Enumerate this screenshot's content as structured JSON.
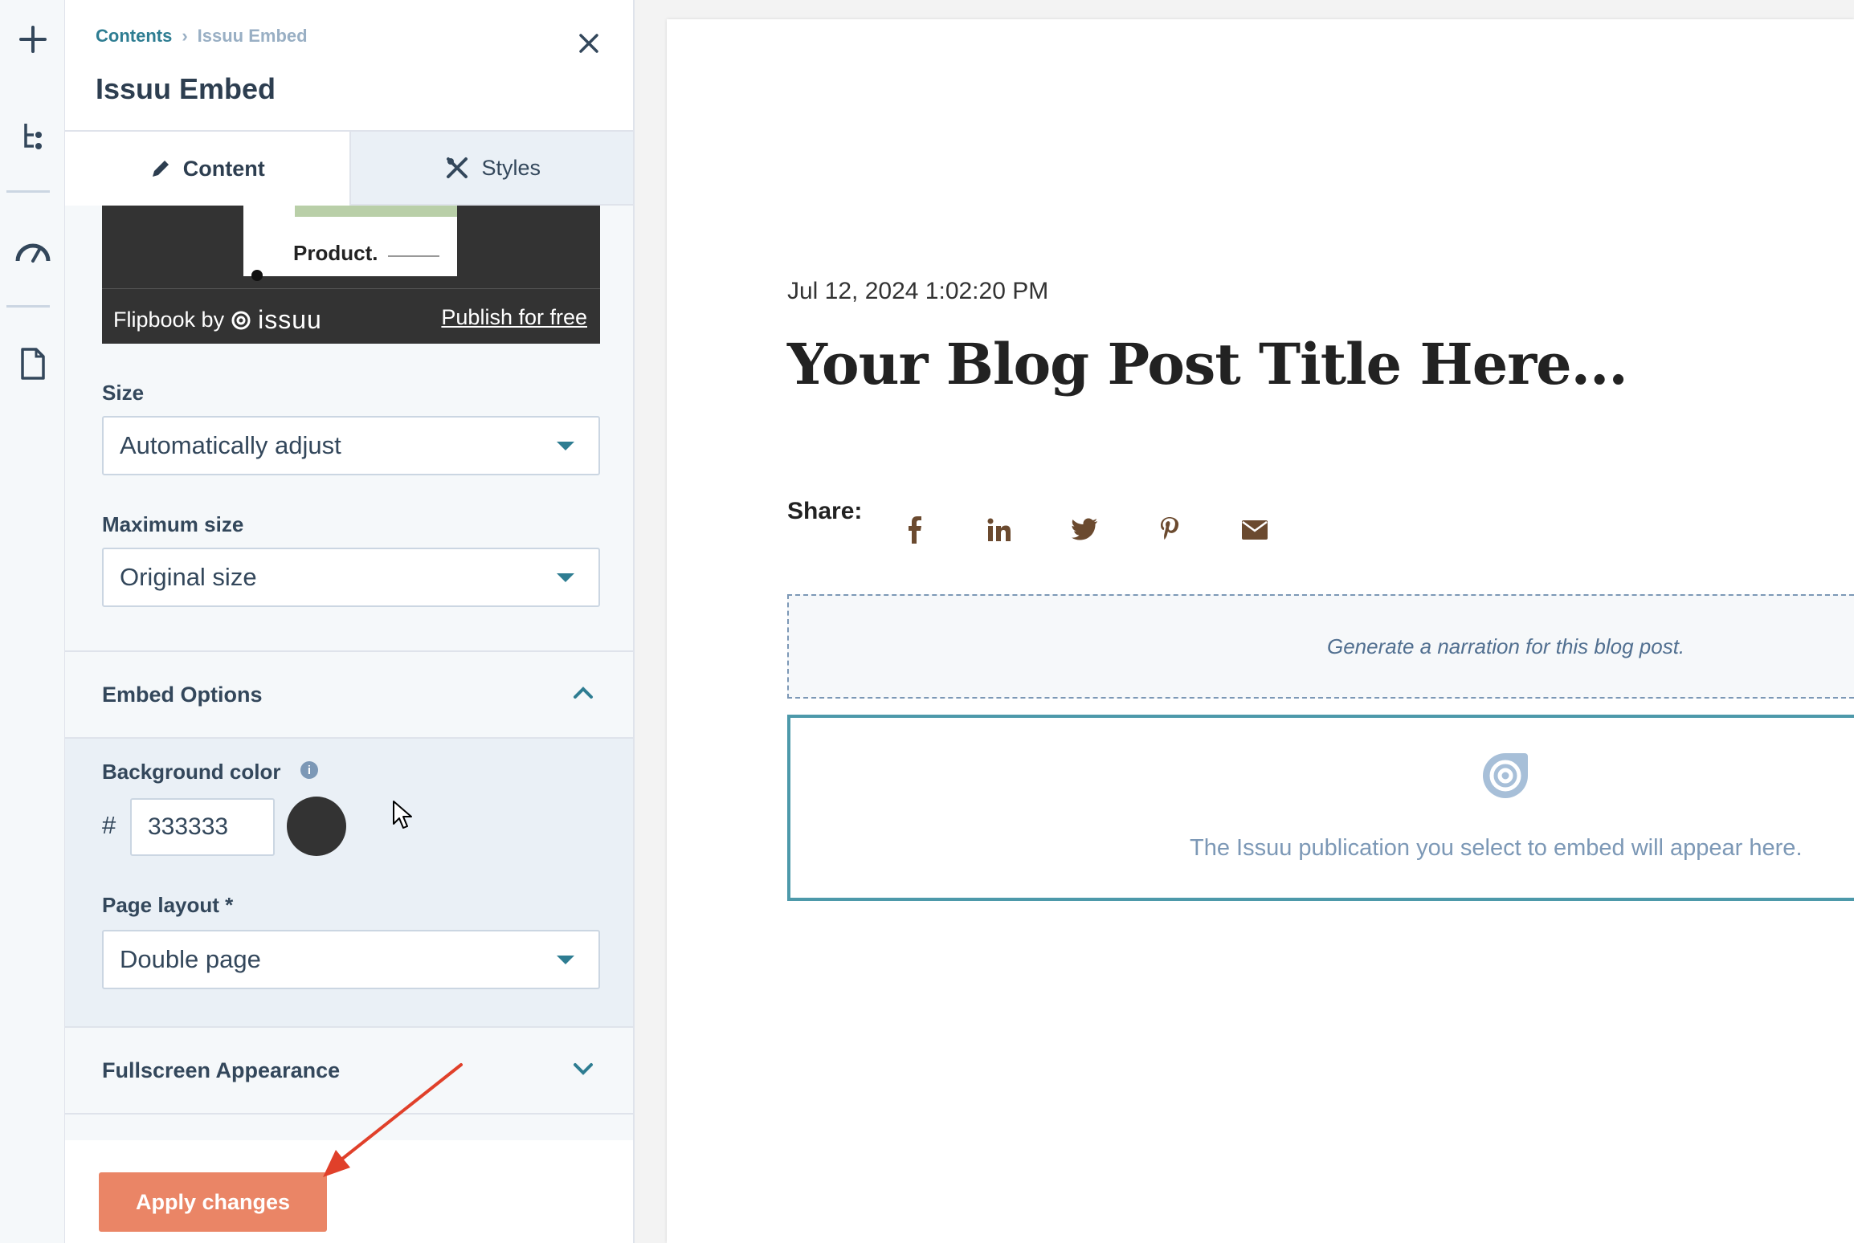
{
  "rail": {
    "icons": [
      "plus-icon",
      "tree-icon",
      "gauge-icon",
      "document-icon"
    ]
  },
  "panel": {
    "breadcrumb": {
      "parent": "Contents",
      "current": "Issuu Embed"
    },
    "title": "Issuu Embed",
    "tabs": [
      {
        "label": "Content"
      },
      {
        "label": "Styles"
      }
    ],
    "preview": {
      "page_text": "Product.",
      "flipbook_by": "Flipbook by",
      "brand": "issuu",
      "publish_link": "Publish for free"
    },
    "size": {
      "label": "Size",
      "value": "Automatically adjust"
    },
    "max_size": {
      "label": "Maximum size",
      "value": "Original size"
    },
    "embed_options": {
      "title": "Embed Options",
      "expanded": true
    },
    "background_color": {
      "label": "Background color",
      "hash": "#",
      "value": "333333",
      "swatch": "#333333"
    },
    "page_layout": {
      "label": "Page layout *",
      "value": "Double page"
    },
    "fullscreen": {
      "title": "Fullscreen Appearance",
      "expanded": false
    },
    "apply_label": "Apply changes"
  },
  "canvas": {
    "date": "Jul 12, 2024 1:02:20 PM",
    "title": "Your Blog Post Title Here...",
    "share_label": "Share:",
    "share_icons": [
      "facebook-icon",
      "linkedin-icon",
      "twitter-icon",
      "pinterest-icon",
      "email-icon"
    ],
    "narration": "Generate a narration for this blog post.",
    "issuu_placeholder": "The Issuu publication you select to embed will appear here."
  },
  "colors": {
    "accent": "#2e7d92",
    "apply": "#ea8566",
    "share_icons": "#6b4a2f",
    "annotation_arrow": "#e0402a"
  }
}
